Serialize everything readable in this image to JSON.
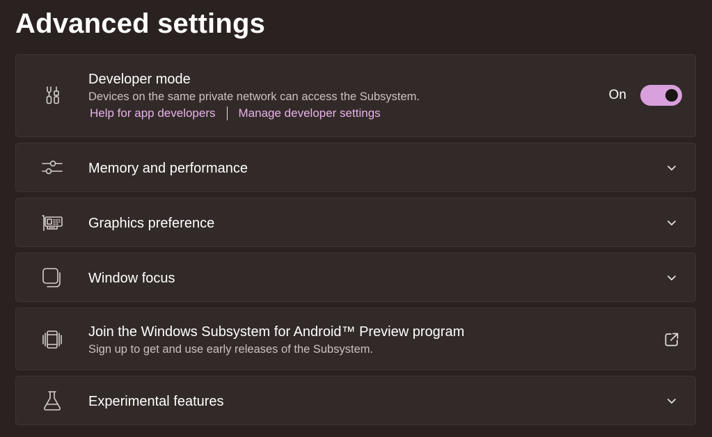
{
  "page": {
    "title": "Advanced settings"
  },
  "developer_mode": {
    "icon": "developer-tools-icon",
    "title": "Developer mode",
    "description": "Devices on the same private network can access the Subsystem.",
    "link_help": "Help for app developers",
    "link_manage": "Manage developer settings",
    "toggle_label": "On",
    "toggle_state": true
  },
  "memory_performance": {
    "icon": "sliders-icon",
    "title": "Memory and performance"
  },
  "graphics_preference": {
    "icon": "graphics-card-icon",
    "title": "Graphics preference"
  },
  "window_focus": {
    "icon": "window-focus-icon",
    "title": "Window focus"
  },
  "preview_program": {
    "icon": "preview-program-icon",
    "title": "Join the Windows Subsystem for Android™ Preview program",
    "description": "Sign up to get and use early releases of the Subsystem."
  },
  "experimental_features": {
    "icon": "flask-icon",
    "title": "Experimental features"
  },
  "colors": {
    "background": "#2a2220",
    "card": "#322a28",
    "accent": "#d8a0dc",
    "link": "#e8b2ea"
  }
}
